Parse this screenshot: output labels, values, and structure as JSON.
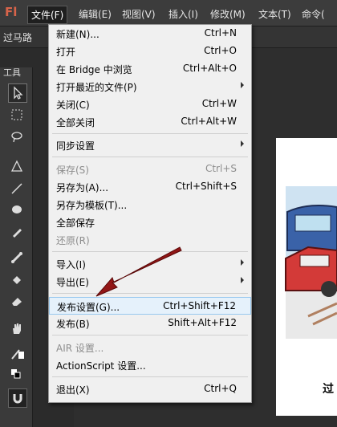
{
  "app": {
    "logo": "Fl"
  },
  "menubar": [
    {
      "label": "文件(F)",
      "active": true
    },
    {
      "label": "编辑(E)"
    },
    {
      "label": "视图(V)"
    },
    {
      "label": "插入(I)"
    },
    {
      "label": "修改(M)"
    },
    {
      "label": "文本(T)"
    },
    {
      "label": "命令("
    }
  ],
  "tab": {
    "label": "过马路"
  },
  "toolpanel": {
    "title": "工具"
  },
  "stage": {
    "caption": "过"
  },
  "file_menu": {
    "items": [
      {
        "label": "新建(N)...",
        "shortcut": "Ctrl+N"
      },
      {
        "label": "打开",
        "shortcut": "Ctrl+O"
      },
      {
        "label": "在 Bridge 中浏览",
        "shortcut": "Ctrl+Alt+O"
      },
      {
        "label": "打开最近的文件(P)",
        "shortcut": ""
      },
      {
        "label": "关闭(C)",
        "shortcut": "Ctrl+W"
      },
      {
        "label": "全部关闭",
        "shortcut": "Ctrl+Alt+W"
      },
      {
        "label": "同步设置",
        "shortcut": ""
      },
      {
        "label": "保存(S)",
        "shortcut": "Ctrl+S"
      },
      {
        "label": "另存为(A)...",
        "shortcut": "Ctrl+Shift+S"
      },
      {
        "label": "另存为模板(T)...",
        "shortcut": ""
      },
      {
        "label": "全部保存",
        "shortcut": ""
      },
      {
        "label": "还原(R)",
        "shortcut": ""
      },
      {
        "label": "导入(I)",
        "shortcut": ""
      },
      {
        "label": "导出(E)",
        "shortcut": ""
      },
      {
        "label": "发布设置(G)...",
        "shortcut": "Ctrl+Shift+F12"
      },
      {
        "label": "发布(B)",
        "shortcut": "Shift+Alt+F12"
      },
      {
        "label": "AIR 设置...",
        "shortcut": ""
      },
      {
        "label": "ActionScript 设置...",
        "shortcut": ""
      },
      {
        "label": "退出(X)",
        "shortcut": "Ctrl+Q"
      }
    ]
  }
}
